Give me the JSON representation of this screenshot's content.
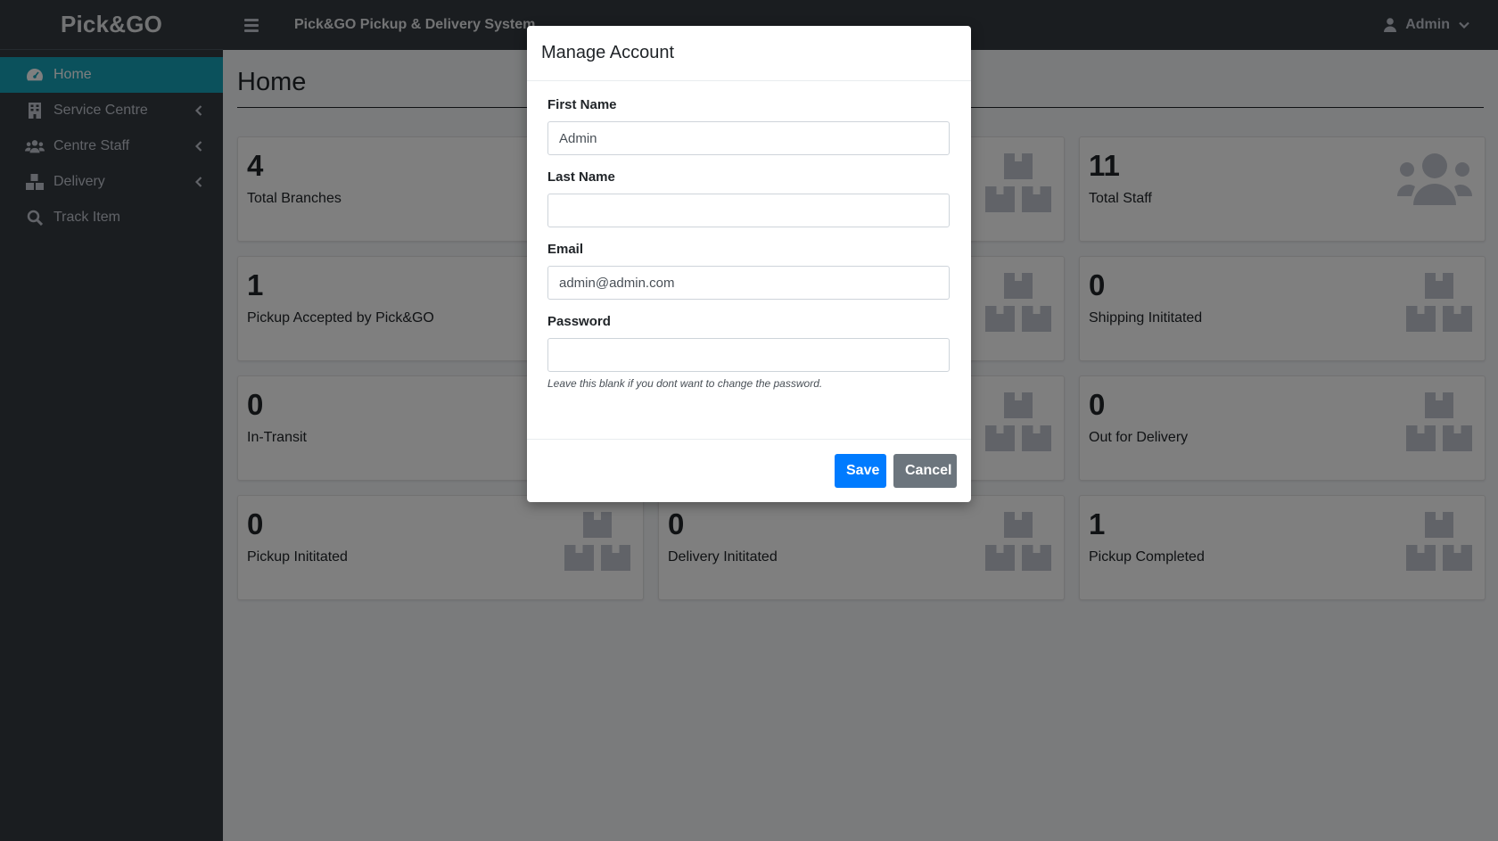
{
  "brand": {
    "name": "Pick&GO"
  },
  "sidebar": {
    "items": [
      {
        "label": "Home",
        "icon": "tachometer-icon",
        "active": true,
        "has_submenu": false
      },
      {
        "label": "Service Centre",
        "icon": "building-icon",
        "active": false,
        "has_submenu": true
      },
      {
        "label": "Centre Staff",
        "icon": "users-icon",
        "active": false,
        "has_submenu": true
      },
      {
        "label": "Delivery",
        "icon": "boxes-icon",
        "active": false,
        "has_submenu": true
      },
      {
        "label": "Track Item",
        "icon": "search-icon",
        "active": false,
        "has_submenu": false
      }
    ]
  },
  "topbar": {
    "menu_icon": "hamburger-icon",
    "title": "Pick&GO Pickup & Delivery System",
    "user_name": "Admin",
    "user_icon": "user-icon",
    "caret_icon": "chevron-down-icon"
  },
  "page": {
    "title": "Home"
  },
  "cards": [
    {
      "value": "4",
      "label": "Total Branches",
      "icon": "building-icon"
    },
    {
      "value": "",
      "label": "",
      "icon": "boxes-icon"
    },
    {
      "value": "11",
      "label": "Total Staff",
      "icon": "users-icon"
    },
    {
      "value": "1",
      "label": "Pickup Accepted by Pick&GO",
      "icon": "boxes-icon"
    },
    {
      "value": "",
      "label": "",
      "icon": "boxes-icon"
    },
    {
      "value": "0",
      "label": "Shipping Inititated",
      "icon": "boxes-icon"
    },
    {
      "value": "0",
      "label": "In-Transit",
      "icon": "boxes-icon"
    },
    {
      "value": "",
      "label": "",
      "icon": "boxes-icon"
    },
    {
      "value": "0",
      "label": "Out for Delivery",
      "icon": "boxes-icon"
    },
    {
      "value": "0",
      "label": "Pickup Inititated",
      "icon": "boxes-icon"
    },
    {
      "value": "0",
      "label": "Delivery Inititated",
      "icon": "boxes-icon"
    },
    {
      "value": "1",
      "label": "Pickup Completed",
      "icon": "boxes-icon"
    }
  ],
  "modal": {
    "title": "Manage Account",
    "first_name": {
      "label": "First Name",
      "value": "Admin"
    },
    "last_name": {
      "label": "Last Name",
      "value": ""
    },
    "email": {
      "label": "Email",
      "value": "admin@admin.com"
    },
    "password": {
      "label": "Password",
      "value": ""
    },
    "password_hint": "Leave this blank if you dont want to change the password.",
    "save_label": "Save",
    "cancel_label": "Cancel"
  },
  "colors": {
    "sidebar_bg": "#343a40",
    "active_item": "#17a2b8",
    "primary_button": "#007bff",
    "secondary_button": "#6c757d"
  }
}
